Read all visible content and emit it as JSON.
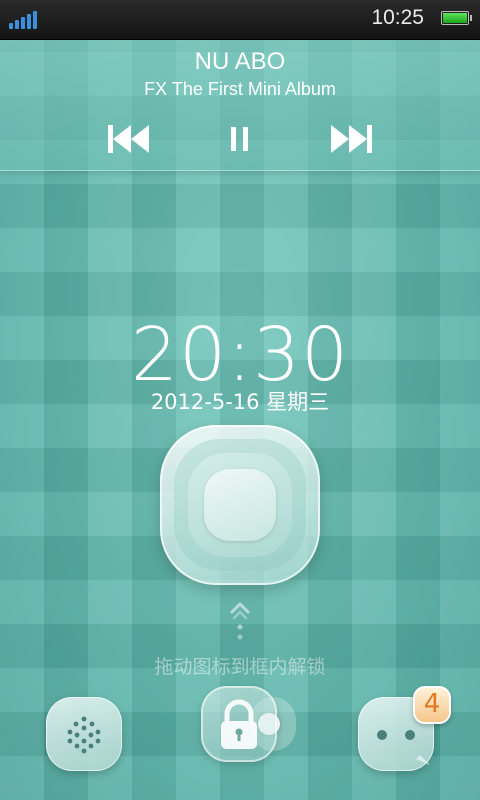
{
  "status_bar": {
    "time": "10:25",
    "signal_icon": "signal-bars-icon",
    "battery_icon": "battery-full-icon",
    "signal_color": "#3b8fe0",
    "battery_color": "#2ec22e"
  },
  "music": {
    "title": "NU ABO",
    "album": "FX The First Mini Album",
    "controls": [
      "previous-track-icon",
      "pause-icon",
      "next-track-icon"
    ]
  },
  "clock": {
    "time": "20:30",
    "date": "2012-5-16 星期三"
  },
  "unlock": {
    "hint": "拖动图标到框内解锁",
    "lock_icon": "padlock-icon"
  },
  "dock": {
    "left_icon": "phone-dialpad-icon",
    "right_icon": "message-bubble-icon",
    "message_badge": "4"
  },
  "colors": {
    "background": "#5fb8ad",
    "text": "#ffffff",
    "badge_text": "#e07a20"
  }
}
